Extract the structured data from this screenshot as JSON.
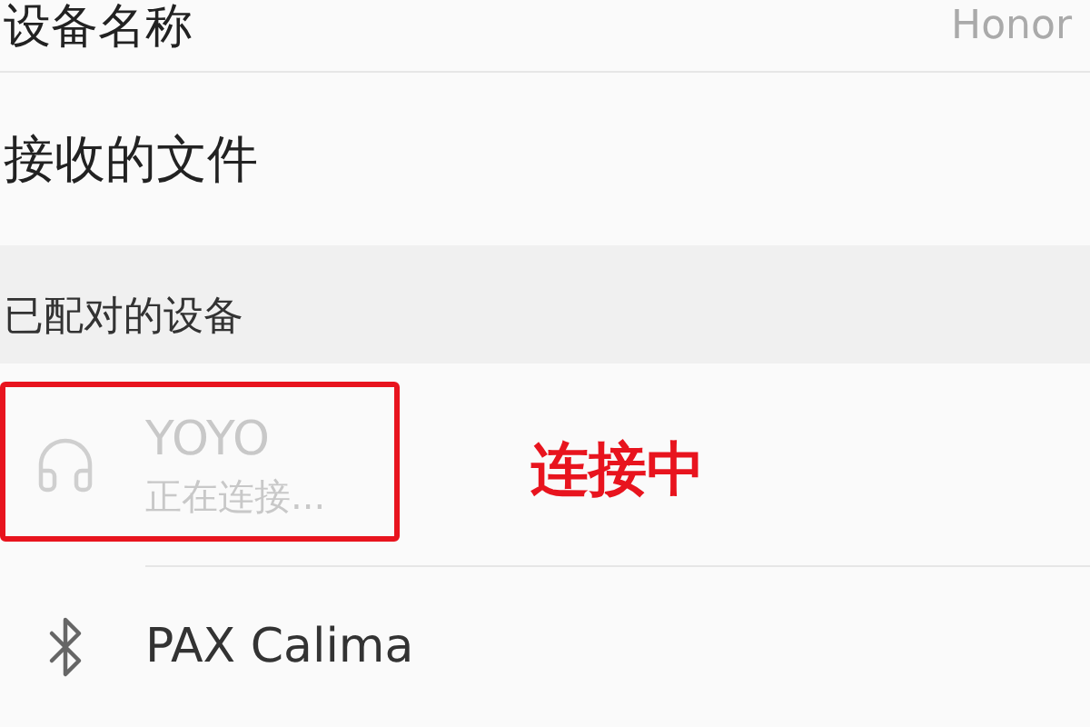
{
  "device_name": {
    "label": "设备名称",
    "value": "Honor"
  },
  "received_files": {
    "label": "接收的文件"
  },
  "paired_section": {
    "title": "已配对的设备"
  },
  "devices": [
    {
      "kind": "headset",
      "name": "YOYO",
      "status": "正在连接...",
      "connecting": true,
      "highlighted": true
    },
    {
      "kind": "bluetooth",
      "name": "PAX Calima",
      "connecting": false,
      "highlighted": false
    }
  ],
  "annotation": {
    "label": "连接中"
  }
}
